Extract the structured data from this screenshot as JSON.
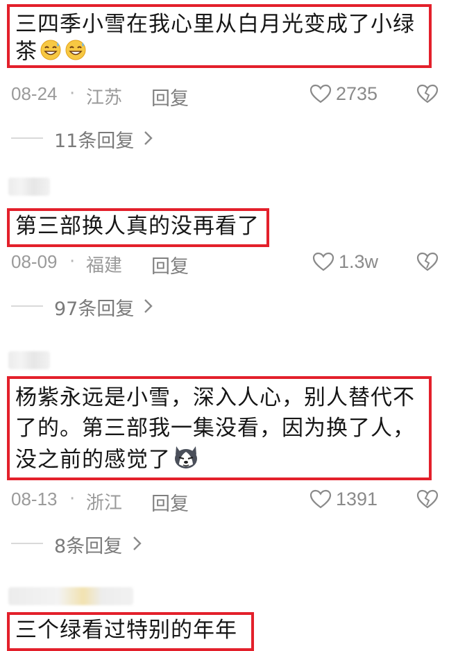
{
  "comments": [
    {
      "text": "三四季小雪在我心里从白月光变成了小绿茶",
      "emoji": [
        "grinning-sweat-emoji",
        "grinning-sweat-emoji"
      ],
      "date": "08-24",
      "separator": "·",
      "location": "江苏",
      "reply_label": "回复",
      "likes": "2735",
      "replies": "11条回复"
    },
    {
      "text": "第三部换人真的没再看了",
      "emoji": [],
      "date": "08-09",
      "separator": "·",
      "location": "福建",
      "reply_label": "回复",
      "likes": "1.3w",
      "replies": "97条回复"
    },
    {
      "text": "杨紫永远是小雪，深入人心，别人替代不了的。第三部我一集没看，因为换了人，没之前的感觉了",
      "emoji": [
        "husky-dog-emoji"
      ],
      "date": "08-13",
      "separator": "·",
      "location": "浙江",
      "reply_label": "回复",
      "likes": "1391",
      "replies": "8条回复"
    },
    {
      "text": "三个绿看过特别的年年",
      "emoji": [],
      "partial": true
    }
  ],
  "colors": {
    "highlight_border": "#e3202b",
    "meta_text": "#9a9a9a",
    "body_text": "#161616"
  }
}
